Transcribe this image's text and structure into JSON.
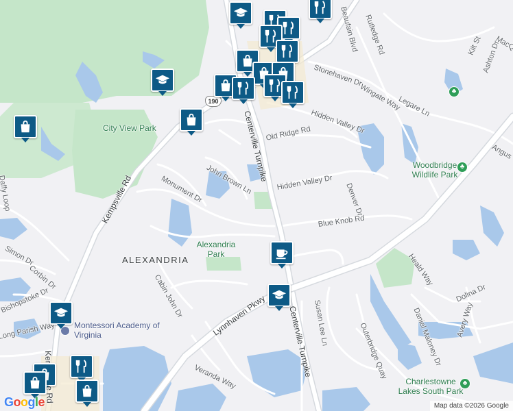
{
  "map": {
    "area_labels": [
      {
        "id": "alexandria",
        "text": "ALEXANDRIA"
      }
    ],
    "streets": [
      {
        "id": "centerville-top",
        "text": "Centerville Turnpike"
      },
      {
        "id": "centerville-bottom",
        "text": "Centerville Turnpike"
      },
      {
        "id": "kempsville",
        "text": "Kempsville Rd"
      },
      {
        "id": "kempsville-bottom",
        "text": "Kempsville Rd"
      },
      {
        "id": "lynnhaven",
        "text": "Lynnhaven Pkwy"
      },
      {
        "id": "john-brown",
        "text": "John Brown Ln"
      },
      {
        "id": "monument",
        "text": "Monument Dr"
      },
      {
        "id": "old-ridge",
        "text": "Old Ridge Rd"
      },
      {
        "id": "hidden-valley-1",
        "text": "Hidden Valley Dr"
      },
      {
        "id": "hidden-valley-2",
        "text": "Hidden Valley Dr"
      },
      {
        "id": "blue-knob",
        "text": "Blue Knob Rd"
      },
      {
        "id": "denver",
        "text": "Denver Dr"
      },
      {
        "id": "stonehaven",
        "text": "Stonehaven Dr"
      },
      {
        "id": "wingate",
        "text": "Wingate Way"
      },
      {
        "id": "legare",
        "text": "Legare Ln"
      },
      {
        "id": "rutledge",
        "text": "Rutledge Rd"
      },
      {
        "id": "beaufain",
        "text": "Beaufain Blvd"
      },
      {
        "id": "kilt",
        "text": "Kilt St"
      },
      {
        "id": "ashton",
        "text": "Ashton Dr"
      },
      {
        "id": "macque",
        "text": "MacQue"
      },
      {
        "id": "angus",
        "text": "Angus"
      },
      {
        "id": "heald",
        "text": "Heald Way"
      },
      {
        "id": "susan-lee",
        "text": "Susan Lee Ln"
      },
      {
        "id": "outerbridge",
        "text": "Outerbridge Quay"
      },
      {
        "id": "daniel-maloney",
        "text": "Daniel Maloney Dr"
      },
      {
        "id": "dolina",
        "text": "Dolina Dr"
      },
      {
        "id": "avery",
        "text": "Avery Way"
      },
      {
        "id": "veranda",
        "text": "Veranda Way"
      },
      {
        "id": "cabin-john",
        "text": "Cabin John Dr"
      },
      {
        "id": "simon",
        "text": "Simon Dr"
      },
      {
        "id": "corbin",
        "text": "Corbin Dr"
      },
      {
        "id": "bishopstoke",
        "text": "Bishopstoke Dr"
      },
      {
        "id": "long-parish",
        "text": "Long Parish Way"
      },
      {
        "id": "daffy-loop",
        "text": "Daffy Loop"
      }
    ],
    "parks": [
      {
        "id": "city-view",
        "text": "City View Park"
      },
      {
        "id": "alexandria-park",
        "text": "Alexandria Park"
      },
      {
        "id": "woodbridge",
        "text": "Woodbridge Wildlife Park"
      },
      {
        "id": "charlestowne",
        "text": "Charlestowne Lakes South Park"
      }
    ],
    "pois": [
      {
        "id": "montessori",
        "text": "Montessori Academy of Virginia"
      }
    ],
    "route_shield": "190",
    "markers": [
      {
        "type": "school"
      },
      {
        "type": "restaurant"
      },
      {
        "type": "restaurant"
      },
      {
        "type": "restaurant"
      },
      {
        "type": "shopping"
      },
      {
        "type": "school"
      },
      {
        "type": "shopping"
      },
      {
        "type": "shopping"
      },
      {
        "type": "cafe"
      },
      {
        "type": "school"
      },
      {
        "type": "school"
      },
      {
        "type": "shopping"
      },
      {
        "type": "restaurant"
      },
      {
        "type": "shopping"
      }
    ],
    "colors": {
      "land": "#f1f1f4",
      "water": "#a9c8ea",
      "park": "#c5e6c9",
      "marker": "#0d5a86",
      "road": "#ffffff"
    }
  },
  "footer": {
    "logo": "Google",
    "attribution": "Map data ©2026 Google"
  }
}
